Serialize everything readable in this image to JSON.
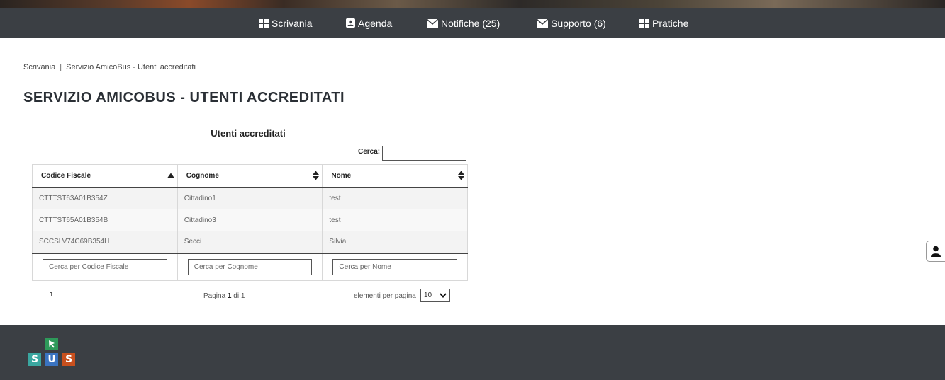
{
  "colors": {
    "nav_bg": "#3b3f44",
    "footer_bg": "#3b3f44",
    "logo_green": "#2e9a5a",
    "logo_teal": "#3aa6a0",
    "logo_blue": "#3a73c0",
    "logo_orange": "#c8501e"
  },
  "nav": {
    "items": [
      {
        "label": "Scrivania",
        "icon": "grid-icon"
      },
      {
        "label": "Agenda",
        "icon": "contact-book-icon"
      },
      {
        "label": "Notifiche (25)",
        "icon": "envelope-icon"
      },
      {
        "label": "Supporto (6)",
        "icon": "envelope-icon"
      },
      {
        "label": "Pratiche",
        "icon": "grid-icon"
      }
    ]
  },
  "breadcrumb": {
    "home": "Scrivania",
    "separator": "|",
    "current": "Servizio AmicoBus - Utenti accreditati"
  },
  "page_title": "SERVIZIO AMICOBUS - UTENTI ACCREDITATI",
  "table": {
    "caption": "Utenti accreditati",
    "search_label": "Cerca:",
    "search_value": "",
    "columns": [
      "Codice Fiscale",
      "Cognome",
      "Nome"
    ],
    "rows": [
      [
        "CTTTST63A01B354Z",
        "Cittadino1",
        "test"
      ],
      [
        "CTTTST65A01B354B",
        "Cittadino3",
        "test"
      ],
      [
        "SCCSLV74C69B354H",
        "Secci",
        "Silvia"
      ]
    ],
    "filters": [
      "Cerca per Codice Fiscale",
      "Cerca per Cognome",
      "Cerca per Nome"
    ]
  },
  "pager": {
    "page_link": "1",
    "info_prefix": "Pagina",
    "current": "1",
    "info_middle": "di",
    "total": "1",
    "per_page_label": "elementi per pagina",
    "per_page_value": "10"
  },
  "side_widget": {
    "icon": "user-icon"
  },
  "footer": {
    "logo_letters": [
      "S",
      "U",
      "S"
    ],
    "logo_icon": "cursor-icon"
  }
}
